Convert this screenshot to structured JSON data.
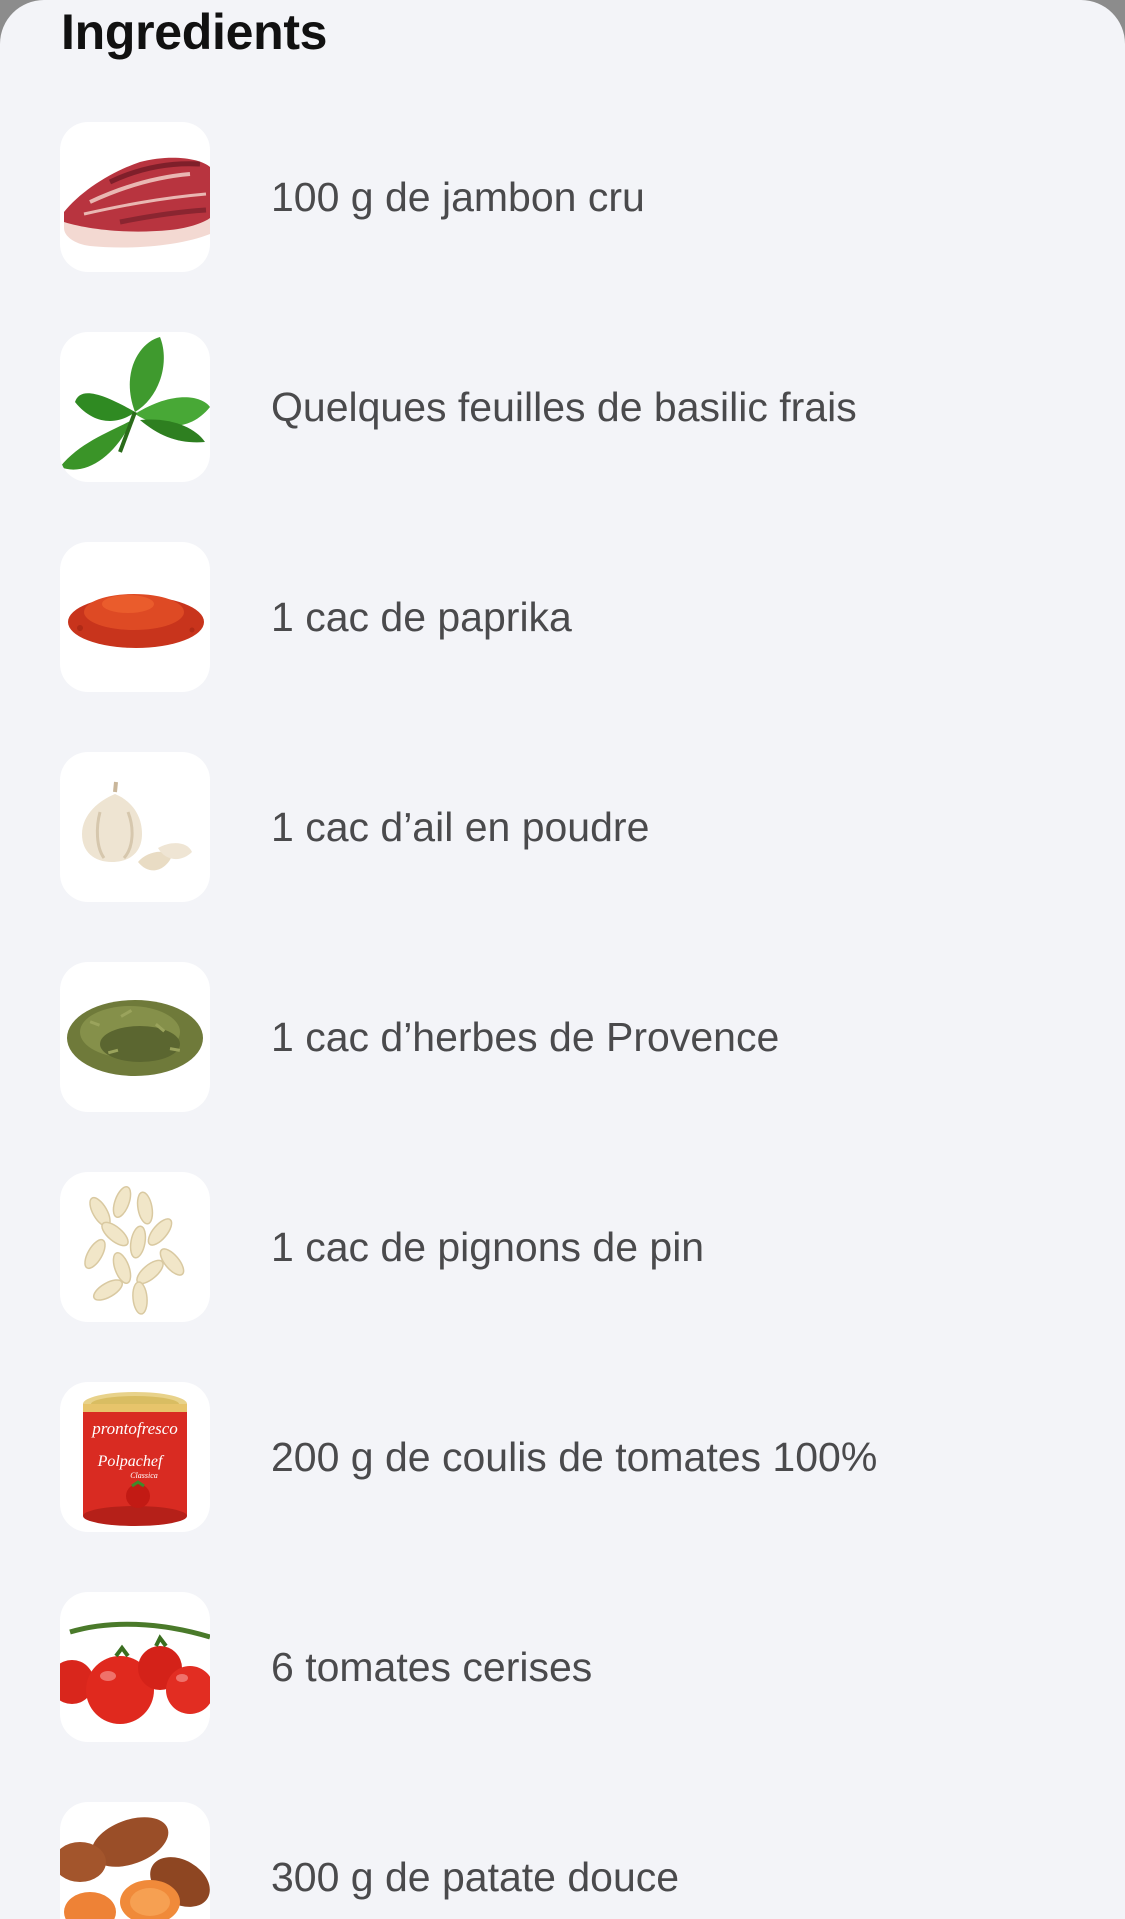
{
  "section": {
    "title": "Ingredients"
  },
  "ingredients": [
    {
      "label": "100 g de jambon cru",
      "icon": "prosciutto-icon"
    },
    {
      "label": "Quelques feuilles de basilic frais",
      "icon": "basil-icon"
    },
    {
      "label": "1 cac de paprika",
      "icon": "paprika-icon"
    },
    {
      "label": "1 cac d’ail en poudre",
      "icon": "garlic-icon"
    },
    {
      "label": "1 cac d’herbes de Provence",
      "icon": "herbs-icon"
    },
    {
      "label": "1 cac de pignons de pin",
      "icon": "pine-nuts-icon"
    },
    {
      "label": "200 g de coulis de tomates 100%",
      "icon": "tomato-can-icon",
      "can_brand": "prontofresco",
      "can_product": "Polpachef",
      "can_variant": "Classica"
    },
    {
      "label": "6 tomates cerises",
      "icon": "cherry-tomatoes-icon"
    },
    {
      "label": "300 g de patate douce",
      "icon": "sweet-potato-icon"
    }
  ],
  "colors": {
    "background": "#f3f4f8",
    "title": "#111111",
    "label": "#4a4a4c",
    "thumb": "#ffffff"
  }
}
